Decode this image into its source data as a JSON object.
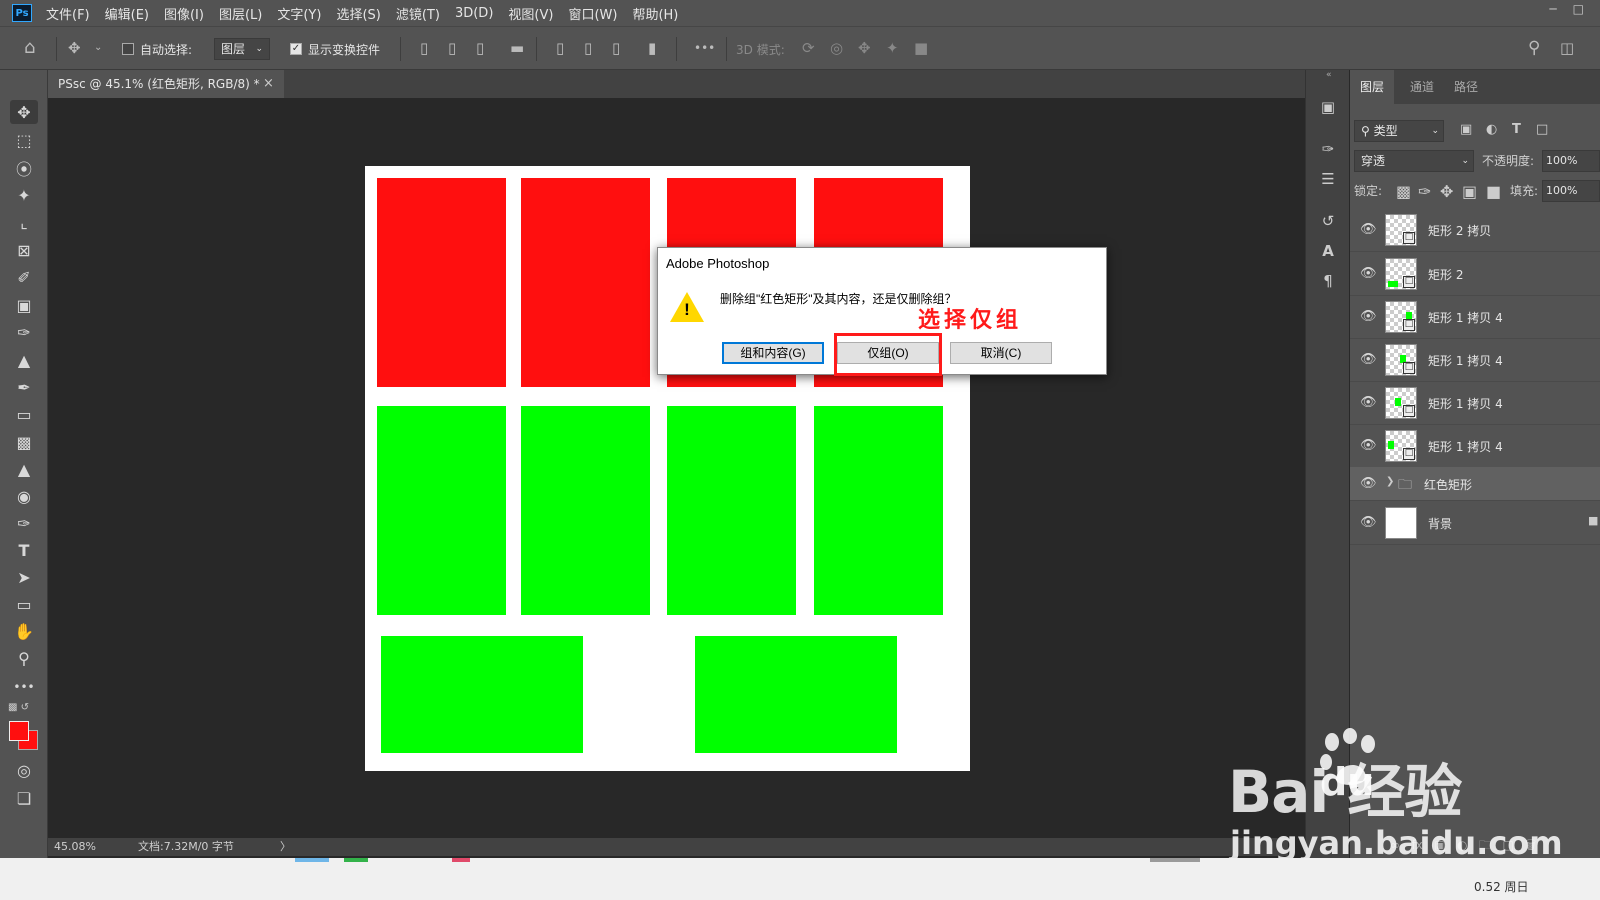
{
  "app": {
    "logo": "Ps"
  },
  "menu": [
    "文件(F)",
    "编辑(E)",
    "图像(I)",
    "图层(L)",
    "文字(Y)",
    "选择(S)",
    "滤镜(T)",
    "3D(D)",
    "视图(V)",
    "窗口(W)",
    "帮助(H)"
  ],
  "options": {
    "auto_select_label": "自动选择:",
    "auto_select_value": "图层",
    "show_transform_label": "显示变换控件",
    "mode_3d_label": "3D 模式:",
    "more": "•••"
  },
  "document_tab": {
    "title": "PSsc @ 45.1% (红色矩形, RGB/8) *",
    "close": "×"
  },
  "status": {
    "zoom": "45.08%",
    "doc_info": "文档:7.32M/0 字节",
    "arrow": "〉"
  },
  "layers_panel": {
    "tabs": [
      "图层",
      "通道",
      "路径"
    ],
    "filter_label": "类型",
    "blend_mode": "穿透",
    "opacity_label": "不透明度:",
    "opacity_value": "100%",
    "lock_label": "锁定:",
    "fill_label": "填充:",
    "fill_value": "100%",
    "layers": [
      {
        "name": "矩形 2 拷贝",
        "type": "shape"
      },
      {
        "name": "矩形 2",
        "type": "shape"
      },
      {
        "name": "矩形 1 拷贝 4",
        "type": "shape"
      },
      {
        "name": "矩形 1 拷贝 4",
        "type": "shape"
      },
      {
        "name": "矩形 1 拷贝 4",
        "type": "shape"
      },
      {
        "name": "矩形 1 拷贝 4",
        "type": "shape"
      },
      {
        "name": "红色矩形",
        "type": "group"
      },
      {
        "name": "背景",
        "type": "background"
      }
    ]
  },
  "dialog": {
    "title": "Adobe Photoshop",
    "message": "删除组\"红色矩形\"及其内容，还是仅删除组？",
    "warning_icon": "!",
    "buttons": {
      "group_and_contents": "组和内容(G)",
      "group_only": "仅组(O)",
      "cancel": "取消(C)"
    }
  },
  "annotation": "选择仅组",
  "colors": {
    "red": "#ff0f0f",
    "green": "#00ff00",
    "annotation": "#ff1a1a"
  },
  "watermark": {
    "brand": "Bai  经验",
    "du": "du",
    "url": "jingyan.baidu.com"
  },
  "taskbar_text": "0.52 周日"
}
